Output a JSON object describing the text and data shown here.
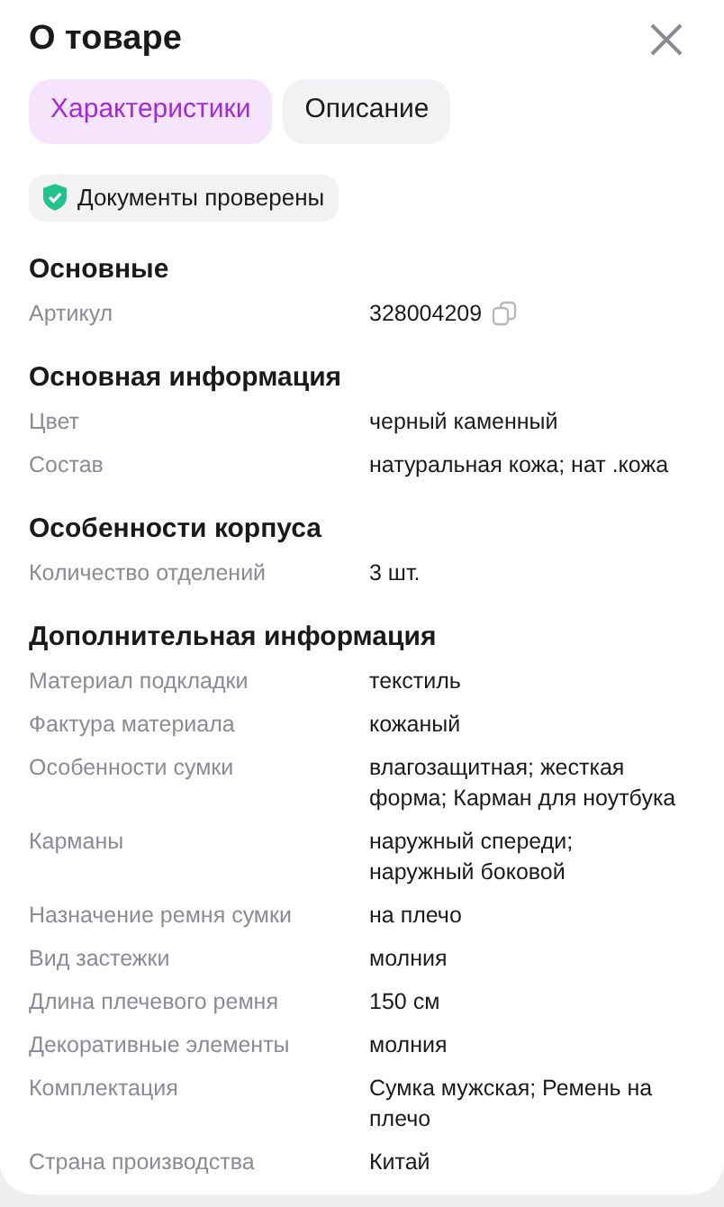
{
  "title": "О товаре",
  "tabs": [
    {
      "label": "Характеристики",
      "selected": true
    },
    {
      "label": "Описание",
      "selected": false
    }
  ],
  "badge": "Документы проверены",
  "sections": [
    {
      "heading": "Основные",
      "rows": [
        {
          "label": "Артикул",
          "value": "328004209",
          "copyable": true
        }
      ]
    },
    {
      "heading": "Основная информация",
      "rows": [
        {
          "label": "Цвет",
          "value": "черный каменный"
        },
        {
          "label": "Состав",
          "value": "натуральная кожа; нат .кожа"
        }
      ]
    },
    {
      "heading": "Особенности корпуса",
      "rows": [
        {
          "label": "Количество отделений",
          "value": "3 шт."
        }
      ]
    },
    {
      "heading": "Дополнительная информация",
      "rows": [
        {
          "label": "Материал подкладки",
          "value": "текстиль"
        },
        {
          "label": "Фактура материала",
          "value": "кожаный"
        },
        {
          "label": "Особенности сумки",
          "value": "влагозащитная; жесткая форма; Карман для ноутбука"
        },
        {
          "label": "Карманы",
          "value": "наружный спереди; наружный боковой"
        },
        {
          "label": "Назначение ремня сумки",
          "value": "на плечо"
        },
        {
          "label": "Вид застежки",
          "value": "молния"
        },
        {
          "label": "Длина плечевого ремня",
          "value": "150 см"
        },
        {
          "label": "Декоративные элементы",
          "value": "молния"
        },
        {
          "label": "Комплектация",
          "value": "Сумка мужская; Ремень на плечо"
        },
        {
          "label": "Страна производства",
          "value": "Китай"
        }
      ]
    }
  ]
}
